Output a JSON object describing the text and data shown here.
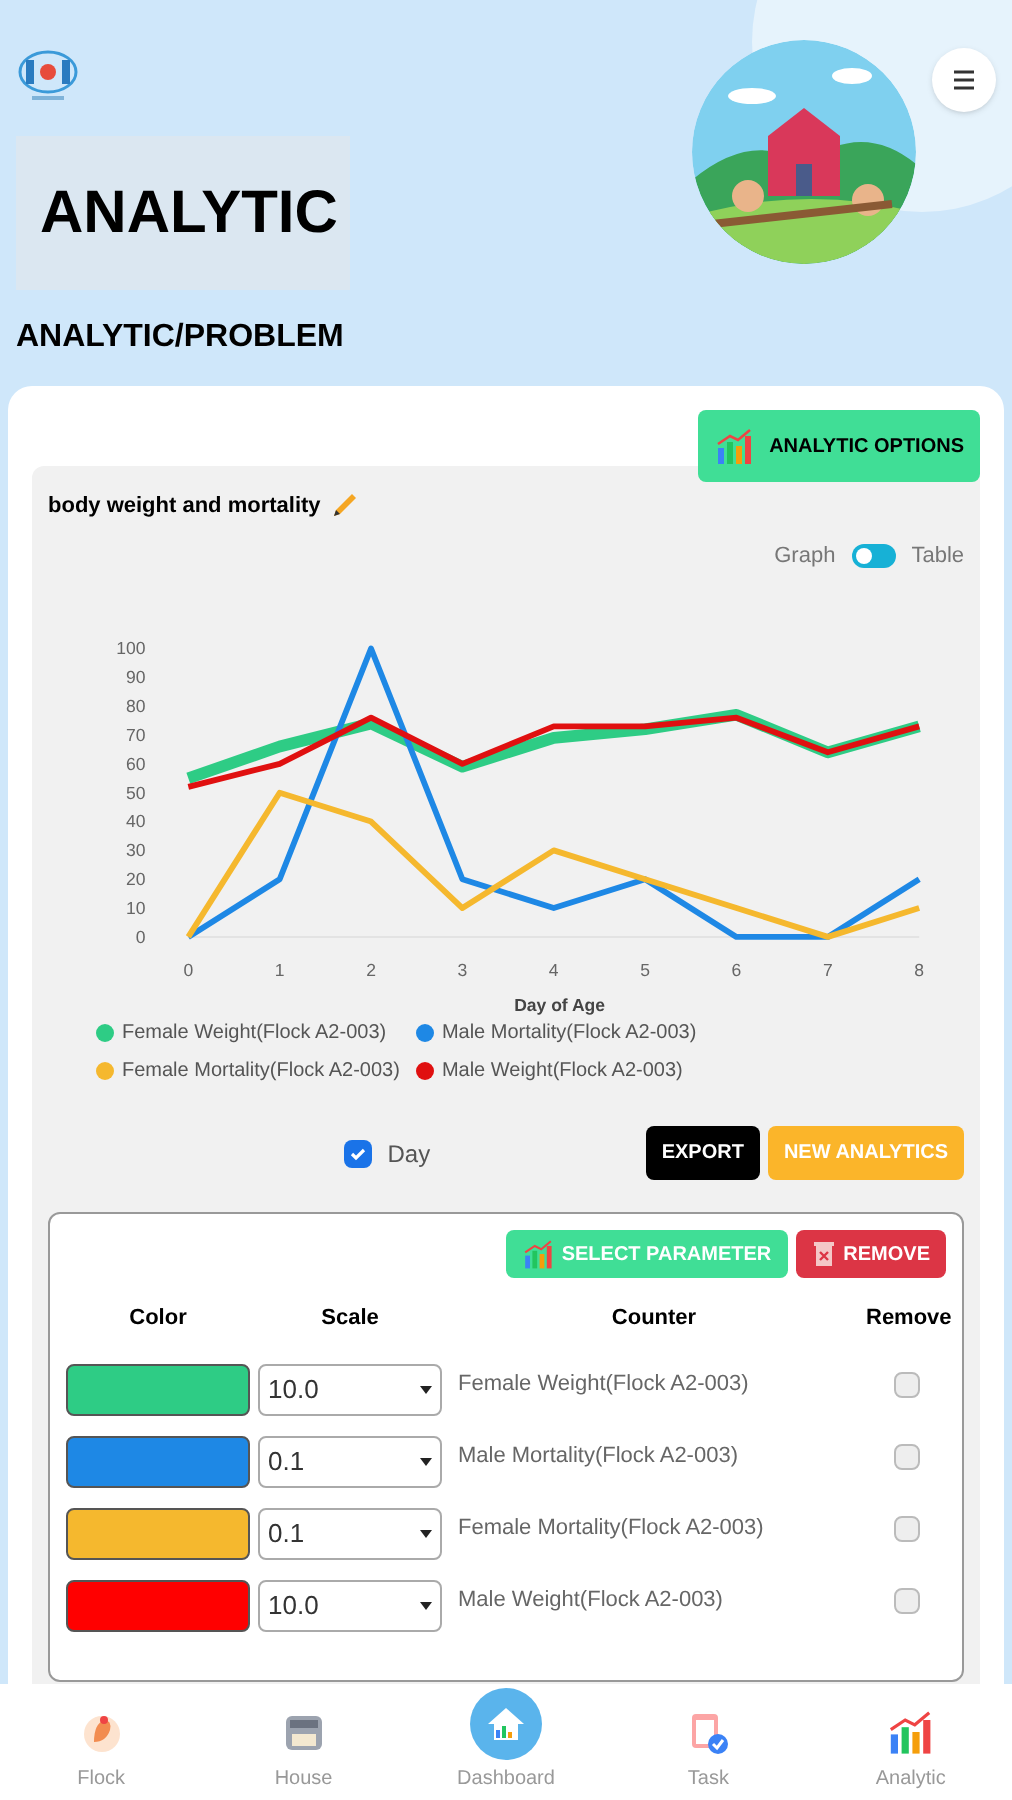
{
  "header": {
    "title": "ANALYTIC",
    "breadcrumb": "ANALYTIC/PROBLEM"
  },
  "options_button": "ANALYTIC OPTIONS",
  "panel": {
    "title": "body weight and mortality",
    "view_toggle": {
      "left_label": "Graph",
      "right_label": "Table",
      "on": false
    },
    "chart_data": {
      "type": "line",
      "xlabel": "Day of Age",
      "x": [
        0,
        1,
        2,
        3,
        4,
        5,
        6,
        7,
        8
      ],
      "xlim": [
        0,
        8
      ],
      "ylim": [
        0,
        100
      ],
      "legend": true,
      "yticks": [
        0,
        10,
        20,
        30,
        40,
        50,
        60,
        70,
        80,
        90,
        100
      ],
      "xticks": [
        0,
        1,
        2,
        3,
        4,
        5,
        6,
        7,
        8
      ],
      "series": [
        {
          "name": "Female Weight(Flock A2-003)",
          "color": "#2ecc85",
          "values": [
            55,
            66,
            74,
            59,
            69,
            72,
            77,
            64,
            73
          ]
        },
        {
          "name": "Male Mortality(Flock A2-003)",
          "color": "#1e88e5",
          "values": [
            0,
            20,
            100,
            20,
            10,
            20,
            0,
            0,
            20
          ]
        },
        {
          "name": "Female Mortality(Flock A2-003)",
          "color": "#f5b82e",
          "values": [
            0,
            50,
            40,
            10,
            30,
            20,
            10,
            0,
            10
          ]
        },
        {
          "name": "Male Weight(Flock A2-003)",
          "color": "#e01010",
          "values": [
            52,
            60,
            76,
            60,
            73,
            73,
            76,
            64,
            73
          ]
        }
      ]
    },
    "day_checkbox": {
      "label": "Day",
      "checked": true
    },
    "export_button": "EXPORT",
    "new_button": "NEW ANALYTICS"
  },
  "parameters": {
    "select_button": "SELECT PARAMETER",
    "remove_button": "REMOVE",
    "columns": [
      "Color",
      "Scale",
      "Counter",
      "Remove"
    ],
    "rows": [
      {
        "color": "#2ecc85",
        "scale": "10.0",
        "counter": "Female Weight(Flock A2-003)",
        "checked": false
      },
      {
        "color": "#1e88e5",
        "scale": "0.1",
        "counter": "Male Mortality(Flock A2-003)",
        "checked": false
      },
      {
        "color": "#f5b82e",
        "scale": "0.1",
        "counter": "Female Mortality(Flock A2-003)",
        "checked": false
      },
      {
        "color": "#ff0000",
        "scale": "10.0",
        "counter": "Male Weight(Flock A2-003)",
        "checked": false
      }
    ]
  },
  "nav": [
    {
      "label": "Flock",
      "kind": "flock"
    },
    {
      "label": "House",
      "kind": "house"
    },
    {
      "label": "Dashboard",
      "kind": "dashboard"
    },
    {
      "label": "Task",
      "kind": "task"
    },
    {
      "label": "Analytic",
      "kind": "analytic"
    }
  ]
}
